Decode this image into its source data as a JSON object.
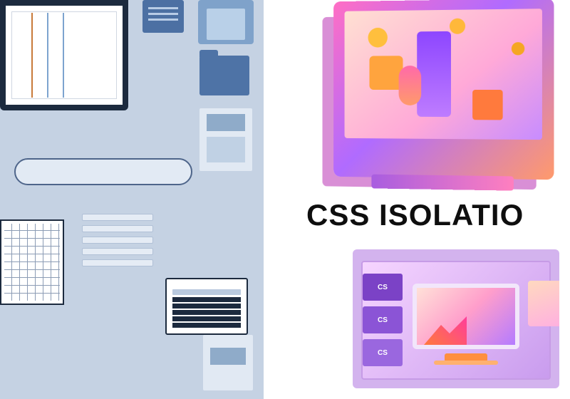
{
  "heading": "CSS ISOLATIO",
  "cs_labels": {
    "a": "CS",
    "b": "CS",
    "c": "CS"
  }
}
